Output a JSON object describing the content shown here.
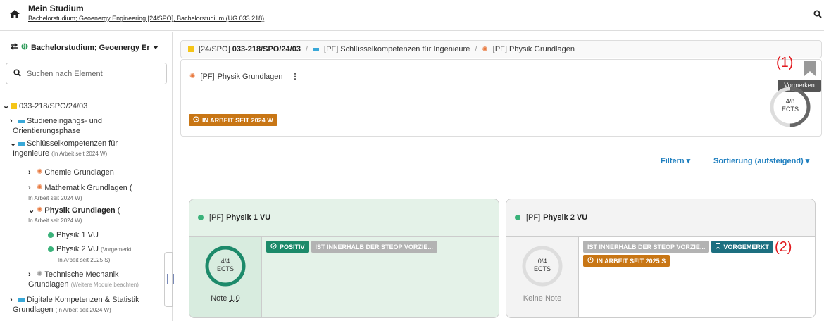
{
  "topbar": {
    "title": "Mein Studium",
    "subtitle": "Bachelorstudium; Geoenergy Engineering [24/SPO], Bachelorstudium (UG 033 218)"
  },
  "sidebar": {
    "program": "Bachelorstudium; Geoenergy Er",
    "search_placeholder": "Suchen nach Element",
    "tree": [
      {
        "label": "033-218/SPO/24/03",
        "sub": ""
      },
      {
        "label": "Studieneingangs- und",
        "label2": "Orientierungsphase",
        "sub": ""
      },
      {
        "label": "Schlüsselkompetenzen für",
        "label2": "Ingenieure",
        "sub": "(In Arbeit seit 2024 W)"
      },
      {
        "label": "Chemie Grundlagen",
        "sub": ""
      },
      {
        "label": "Mathematik Grundlagen",
        "label2": "(",
        "sub": "In Arbeit seit 2024 W)"
      },
      {
        "label": "Physik Grundlagen",
        "label2": "(",
        "sub": "In Arbeit seit 2024 W)"
      },
      {
        "label": "Physik 1 VU",
        "sub": ""
      },
      {
        "label": "Physik 2 VU",
        "sub": "(Vorgemerkt,",
        "sub2": "In Arbeit seit 2025 S)"
      },
      {
        "label": "Technische Mechanik",
        "label2": "Grundlagen",
        "sub": "(Weitere Module beachten)"
      },
      {
        "label": "Digitale Kompetenzen & Statistik",
        "label2": "Grundlagen",
        "sub": "(In Arbeit seit 2024 W)"
      }
    ]
  },
  "breadcrumb": {
    "item1_prefix": "[24/SPO]",
    "item1": "033-218/SPO/24/03",
    "item2_prefix": "[PF]",
    "item2": "Schlüsselkompetenzen für Ingenieure",
    "item3_prefix": "[PF]",
    "item3": "Physik Grundlagen"
  },
  "header_card": {
    "prefix": "[PF]",
    "title": "Physik Grundlagen",
    "status_badge": "IN ARBEIT SEIT 2024 W",
    "ects_value": "4/8",
    "ects_unit": "ECTS",
    "ects_progress": 0.5,
    "tooltip": "Vormerken",
    "annotation": "(1)"
  },
  "controls": {
    "filter": "Filtern",
    "sort": "Sortierung (aufsteigend)"
  },
  "cards": [
    {
      "prefix": "[PF]",
      "title": "Physik 1 VU",
      "ects_value": "4/4",
      "ects_unit": "ECTS",
      "ects_progress": 1.0,
      "grade_label": "Note",
      "grade": "1,0",
      "badge_positive": "POSITIV",
      "badge_steop": "IST INNERHALB DER STEOP VORZIE..."
    },
    {
      "prefix": "[PF]",
      "title": "Physik 2 VU",
      "ects_value": "0/4",
      "ects_unit": "ECTS",
      "ects_progress": 0.0,
      "grade_label": "Keine Note",
      "badge_steop": "IST INNERHALB DER STEOP VORZIE...",
      "badge_bookmarked": "VORGEMERKT",
      "badge_status": "IN ARBEIT SEIT 2025 S",
      "annotation": "(2)"
    }
  ],
  "colors": {
    "accent_blue": "#1f7fbf",
    "status_orange": "#c87615",
    "positive_green": "#1c8a6a",
    "annotation_red": "#e2181d"
  }
}
